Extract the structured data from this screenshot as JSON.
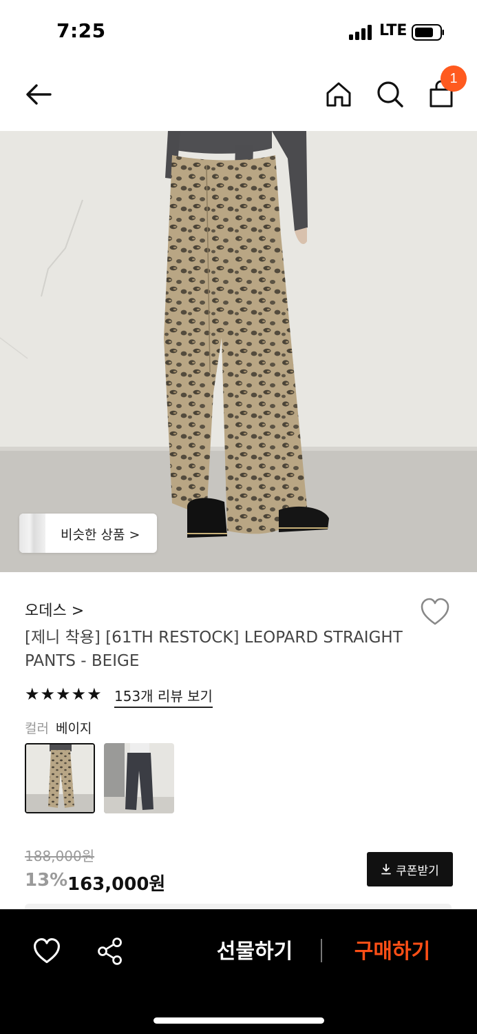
{
  "status_bar": {
    "time": "7:25",
    "network": "LTE"
  },
  "header": {
    "back_icon": "arrow-left-icon",
    "home_icon": "home-icon",
    "search_icon": "search-icon",
    "bag_icon": "shopping-bag-icon",
    "cart_badge": "1"
  },
  "hero": {
    "similar_products_label": "비슷한 상품 >"
  },
  "product": {
    "brand": "오데스 >",
    "title": "[제니 착용] [61TH RESTOCK] LEOPARD STRAIGHT PANTS - BEIGE",
    "stars": "★★★★★",
    "review_link": "153개 리뷰 보기",
    "color_key": "컬러",
    "color_value": "베이지",
    "swatches": [
      "leopard-beige",
      "charcoal"
    ]
  },
  "price": {
    "original": "188,000원",
    "discount": "13%",
    "sale": "163,000원",
    "coupon_label": "쿠폰받기"
  },
  "bottom_bar": {
    "gift_label": "선물하기",
    "buy_label": "구매하기"
  },
  "colors": {
    "accent": "#ff5a1f",
    "buy": "#ff4f16",
    "bar_bg": "#000000"
  }
}
